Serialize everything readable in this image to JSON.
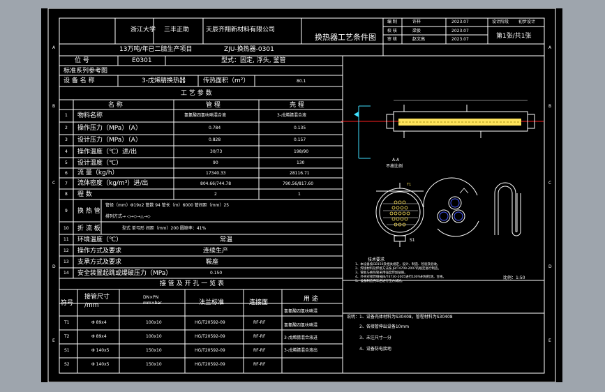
{
  "frame_letters": {
    "left": [
      "A",
      "B",
      "C",
      "D",
      "E"
    ],
    "right": [
      "A",
      "B",
      "C",
      "D",
      "E"
    ]
  },
  "title_block": {
    "university": "浙江大学",
    "name": "三丰正助",
    "company": "天辰齐翔新材料有限公司",
    "project": "13万吨/年已二腈生产项目",
    "drawing_no": "ZJU-换热器-0301",
    "title": "换热器工艺条件图",
    "roles": [
      {
        "role": "编 制",
        "name": "许梓",
        "date": "2023.07"
      },
      {
        "role": "校 核",
        "name": "梁俊",
        "date": "2023.07"
      },
      {
        "role": "审 核",
        "name": "赵文高",
        "date": "2023.07"
      }
    ],
    "stage_label": "设计阶段",
    "stage_value": "初步设计",
    "sheet": "第1张/共1张"
  },
  "header": {
    "position_label": "位 号",
    "position_value": "E0301",
    "type_label": "型式：固定, 浮头, 釜管",
    "ref_label": "标准系列参考图",
    "equip_label": "设 备 名 称",
    "equip_value": "3-戊烯腈换热器",
    "area_label": "传热面积（m²）",
    "area_value": "80.1"
  },
  "process": {
    "title": "工 艺 参 数",
    "col_name": "名 称",
    "col_tube": "管 程",
    "col_shell": "壳 程",
    "rows": [
      {
        "no": "1",
        "name": "物料名称",
        "tube": "氢氰酸四氢呋喃混合液",
        "shell": "3-戊烯腈混合液"
      },
      {
        "no": "2",
        "name": "操作压力（MPa）（A）",
        "tube": "0.784",
        "shell": "0.135"
      },
      {
        "no": "3",
        "name": "设计压力（MPa）（A）",
        "tube": "0.828",
        "shell": "0.157"
      },
      {
        "no": "4",
        "name": "操作温度（℃）进/出",
        "tube": "30/73",
        "shell": "198/90"
      },
      {
        "no": "5",
        "name": "设计温度（℃）",
        "tube": "90",
        "shell": "130"
      },
      {
        "no": "6",
        "name": "流 量（kg/h）",
        "tube": "17340.33",
        "shell": "28116.71"
      },
      {
        "no": "7",
        "name": "流体密度（kg/m³）进/出",
        "tube": "804.66/744.78",
        "shell": "790.56/817.60"
      },
      {
        "no": "8",
        "name": "程 数",
        "tube": "2",
        "shell": "1"
      }
    ],
    "tube_label": "换 热 管",
    "tube_line1": "管径（mm）Φ19x2  管数 94 管长（m）6000  管间距（mm）25",
    "tube_line2": "排列方式→ ◁→◇→△→◇",
    "baffle_no": "10",
    "baffle_label": "折 流 板",
    "baffle_value": "型式 单弓形   间距（mm）200    圆缺率：41%",
    "extra_rows": [
      {
        "no": "11",
        "name": "环境温度（℃）",
        "value": "常温"
      },
      {
        "no": "12",
        "name": "操作方式及要求",
        "value": "连续生产"
      },
      {
        "no": "13",
        "name": "支承方式及要求",
        "value": "鞍座"
      },
      {
        "no": "14",
        "name": "安全装置起跳或爆破压力（MPa）",
        "value": "0.150"
      }
    ]
  },
  "nozzles": {
    "title": "接 管 及 开 孔 一 览 表",
    "col_sym": "符号",
    "col_size": "接管尺寸\n/mm",
    "col_dn": "DN×PN\nmm×bar",
    "col_flange": "法兰标准",
    "col_face": "连接面",
    "col_use": "用 途",
    "rows": [
      {
        "sym": "T1",
        "size": "Φ 89x4",
        "dn": "100x10",
        "flange": "HG/T20592-09",
        "face": "RF-RF",
        "use": "氢氰酸四氢呋喃混"
      },
      {
        "sym": "T2",
        "size": "Φ 89x4",
        "dn": "100x10",
        "flange": "HG/T20592-09",
        "face": "RF-RF",
        "use": "氢氰酸四氢呋喃混"
      },
      {
        "sym": "S1",
        "size": "Φ 140x5",
        "dn": "150x10",
        "flange": "HG/T20592-09",
        "face": "RF-RF",
        "use": "3-戊烯腈混合液进"
      },
      {
        "sym": "S2",
        "size": "Φ 140x5",
        "dn": "150x10",
        "flange": "HG/T20592-09",
        "face": "RF-RF",
        "use": "3-戊烯腈混合液出"
      }
    ]
  },
  "drawing": {
    "tech_title": "技术要求",
    "tech_notes": [
      "1、本设备按GB150及相关规定，设计、制造、检验及验收。",
      "2、焊接材料及焊接方法按 JB/T4709-2007的规定进行制造。",
      "3、管板与换热管采用强度焊加贴胀。",
      "4、外壳对接焊缝按JB/T4730-2005进行100%射线检测，合格。",
      "5、设备制造完毕后进行压力试验。"
    ],
    "scale_label": "比例：1:50",
    "section_label": "A-A",
    "section_sub": "不按比例",
    "s1_label": "S1"
  },
  "notes": [
    "说明：1、设备壳体材料为S30408，管程材料为S30408",
    "2、各接管伸出设备10mm",
    "3、未注尺寸一分",
    "4、设备防电接地"
  ],
  "colors": {
    "background": "#9ea5ad",
    "sheet": "#000000",
    "line": "#ffffff",
    "accent": "#ffe45c",
    "red": "#ff2020",
    "cyan": "#3fe0ff",
    "blue": "#4a5cff"
  }
}
